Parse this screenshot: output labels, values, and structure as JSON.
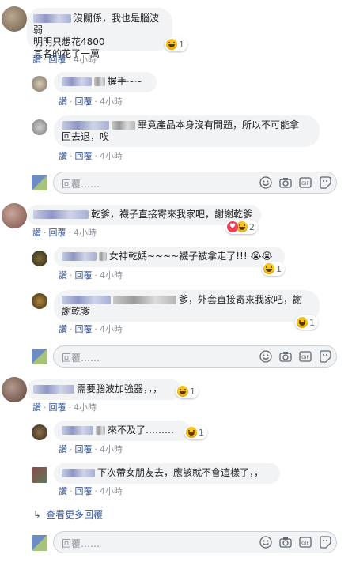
{
  "actions": {
    "like": "讚",
    "reply": "回覆"
  },
  "input_placeholder": "回覆……",
  "comments": [
    {
      "text1": "沒關係，我也是腦波弱",
      "text2": "明明只想花4800",
      "text3": "其名的花了一萬",
      "reaction_count": "1",
      "time": "4小時"
    },
    {
      "text": "握手~~",
      "time": "4小時"
    },
    {
      "text1": "畢竟產品本身沒有問題，所以不可能拿",
      "text2": "回去退，唉",
      "time": "4小時"
    },
    {
      "text": "乾爹，襪子直接寄來我家吧，謝謝乾爹",
      "reaction_count": "2",
      "time": "4小時"
    },
    {
      "text": "女神乾媽~~~~襪子被拿走了!!! 😭😭",
      "reaction_count": "1",
      "time": "4小時"
    },
    {
      "text1": "爹，外套直接寄來我家吧，謝",
      "text2": "謝乾爹",
      "reaction_count": "1",
      "time": "4小時"
    },
    {
      "text": "需要腦波加強器，，，",
      "reaction_count": "1",
      "time": "4小時"
    },
    {
      "text": "來不及了………",
      "reaction_count": "1",
      "time": "4小時"
    },
    {
      "text": "下次帶女朋友去，應該就不會這樣了，，",
      "time": "4小時"
    }
  ],
  "more_replies": "查看更多回覆",
  "colors": {
    "link": "#385898",
    "bubble": "#f2f3f5",
    "meta": "#90949c"
  },
  "icons": [
    "smiley-icon",
    "camera-icon",
    "gif-icon",
    "sticker-icon",
    "reply-arrow-icon"
  ]
}
